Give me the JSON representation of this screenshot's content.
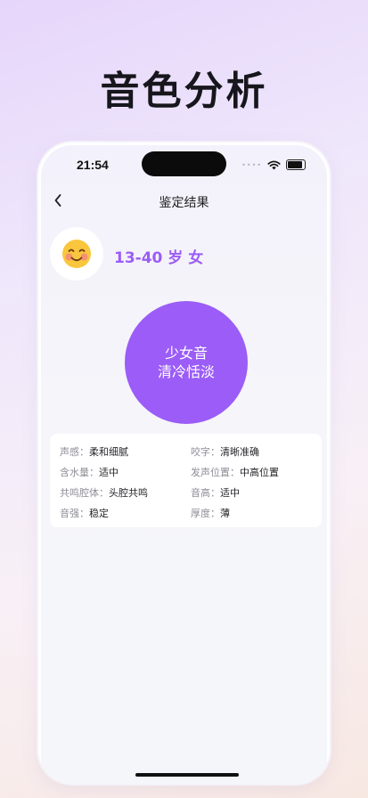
{
  "promo": {
    "title": "音色分析"
  },
  "status_bar": {
    "time": "21:54"
  },
  "nav": {
    "title": "鉴定结果",
    "back_icon": "chevron-left"
  },
  "profile": {
    "avatar_icon": "smiling-face-emoji",
    "age_gender": "13-40 岁 女"
  },
  "voice": {
    "line1": "少女音",
    "line2": "清冷恬淡",
    "color": "#9b5cf7"
  },
  "attributes": {
    "sound_feel": {
      "key": "声感：",
      "value": "柔和细腻"
    },
    "articulation": {
      "key": "咬字：",
      "value": "清晰准确"
    },
    "moisture": {
      "key": "含水量：",
      "value": "适中"
    },
    "position": {
      "key": "发声位置：",
      "value": "中高位置"
    },
    "resonance": {
      "key": "共鸣腔体：",
      "value": "头腔共鸣"
    },
    "pitch": {
      "key": "音高：",
      "value": "适中"
    },
    "strength": {
      "key": "音强：",
      "value": "稳定"
    },
    "thickness": {
      "key": "厚度：",
      "value": "薄"
    }
  },
  "colors": {
    "accent": "#9c5cf6",
    "background_start": "#e6d6fb",
    "background_end": "#f7e8e2"
  }
}
